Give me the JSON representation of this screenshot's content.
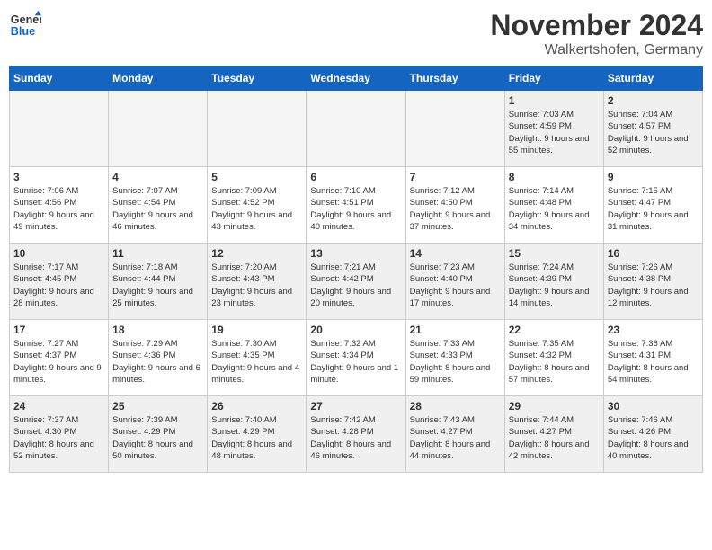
{
  "logo": {
    "line1": "General",
    "line2": "Blue"
  },
  "title": "November 2024",
  "location": "Walkertshofen, Germany",
  "weekdays": [
    "Sunday",
    "Monday",
    "Tuesday",
    "Wednesday",
    "Thursday",
    "Friday",
    "Saturday"
  ],
  "weeks": [
    [
      {
        "day": "",
        "empty": true
      },
      {
        "day": "",
        "empty": true
      },
      {
        "day": "",
        "empty": true
      },
      {
        "day": "",
        "empty": true
      },
      {
        "day": "",
        "empty": true
      },
      {
        "day": "1",
        "info": "Sunrise: 7:03 AM\nSunset: 4:59 PM\nDaylight: 9 hours and 55 minutes."
      },
      {
        "day": "2",
        "info": "Sunrise: 7:04 AM\nSunset: 4:57 PM\nDaylight: 9 hours and 52 minutes."
      }
    ],
    [
      {
        "day": "3",
        "info": "Sunrise: 7:06 AM\nSunset: 4:56 PM\nDaylight: 9 hours and 49 minutes."
      },
      {
        "day": "4",
        "info": "Sunrise: 7:07 AM\nSunset: 4:54 PM\nDaylight: 9 hours and 46 minutes."
      },
      {
        "day": "5",
        "info": "Sunrise: 7:09 AM\nSunset: 4:52 PM\nDaylight: 9 hours and 43 minutes."
      },
      {
        "day": "6",
        "info": "Sunrise: 7:10 AM\nSunset: 4:51 PM\nDaylight: 9 hours and 40 minutes."
      },
      {
        "day": "7",
        "info": "Sunrise: 7:12 AM\nSunset: 4:50 PM\nDaylight: 9 hours and 37 minutes."
      },
      {
        "day": "8",
        "info": "Sunrise: 7:14 AM\nSunset: 4:48 PM\nDaylight: 9 hours and 34 minutes."
      },
      {
        "day": "9",
        "info": "Sunrise: 7:15 AM\nSunset: 4:47 PM\nDaylight: 9 hours and 31 minutes."
      }
    ],
    [
      {
        "day": "10",
        "info": "Sunrise: 7:17 AM\nSunset: 4:45 PM\nDaylight: 9 hours and 28 minutes."
      },
      {
        "day": "11",
        "info": "Sunrise: 7:18 AM\nSunset: 4:44 PM\nDaylight: 9 hours and 25 minutes."
      },
      {
        "day": "12",
        "info": "Sunrise: 7:20 AM\nSunset: 4:43 PM\nDaylight: 9 hours and 23 minutes."
      },
      {
        "day": "13",
        "info": "Sunrise: 7:21 AM\nSunset: 4:42 PM\nDaylight: 9 hours and 20 minutes."
      },
      {
        "day": "14",
        "info": "Sunrise: 7:23 AM\nSunset: 4:40 PM\nDaylight: 9 hours and 17 minutes."
      },
      {
        "day": "15",
        "info": "Sunrise: 7:24 AM\nSunset: 4:39 PM\nDaylight: 9 hours and 14 minutes."
      },
      {
        "day": "16",
        "info": "Sunrise: 7:26 AM\nSunset: 4:38 PM\nDaylight: 9 hours and 12 minutes."
      }
    ],
    [
      {
        "day": "17",
        "info": "Sunrise: 7:27 AM\nSunset: 4:37 PM\nDaylight: 9 hours and 9 minutes."
      },
      {
        "day": "18",
        "info": "Sunrise: 7:29 AM\nSunset: 4:36 PM\nDaylight: 9 hours and 6 minutes."
      },
      {
        "day": "19",
        "info": "Sunrise: 7:30 AM\nSunset: 4:35 PM\nDaylight: 9 hours and 4 minutes."
      },
      {
        "day": "20",
        "info": "Sunrise: 7:32 AM\nSunset: 4:34 PM\nDaylight: 9 hours and 1 minute."
      },
      {
        "day": "21",
        "info": "Sunrise: 7:33 AM\nSunset: 4:33 PM\nDaylight: 8 hours and 59 minutes."
      },
      {
        "day": "22",
        "info": "Sunrise: 7:35 AM\nSunset: 4:32 PM\nDaylight: 8 hours and 57 minutes."
      },
      {
        "day": "23",
        "info": "Sunrise: 7:36 AM\nSunset: 4:31 PM\nDaylight: 8 hours and 54 minutes."
      }
    ],
    [
      {
        "day": "24",
        "info": "Sunrise: 7:37 AM\nSunset: 4:30 PM\nDaylight: 8 hours and 52 minutes."
      },
      {
        "day": "25",
        "info": "Sunrise: 7:39 AM\nSunset: 4:29 PM\nDaylight: 8 hours and 50 minutes."
      },
      {
        "day": "26",
        "info": "Sunrise: 7:40 AM\nSunset: 4:29 PM\nDaylight: 8 hours and 48 minutes."
      },
      {
        "day": "27",
        "info": "Sunrise: 7:42 AM\nSunset: 4:28 PM\nDaylight: 8 hours and 46 minutes."
      },
      {
        "day": "28",
        "info": "Sunrise: 7:43 AM\nSunset: 4:27 PM\nDaylight: 8 hours and 44 minutes."
      },
      {
        "day": "29",
        "info": "Sunrise: 7:44 AM\nSunset: 4:27 PM\nDaylight: 8 hours and 42 minutes."
      },
      {
        "day": "30",
        "info": "Sunrise: 7:46 AM\nSunset: 4:26 PM\nDaylight: 8 hours and 40 minutes."
      }
    ]
  ]
}
